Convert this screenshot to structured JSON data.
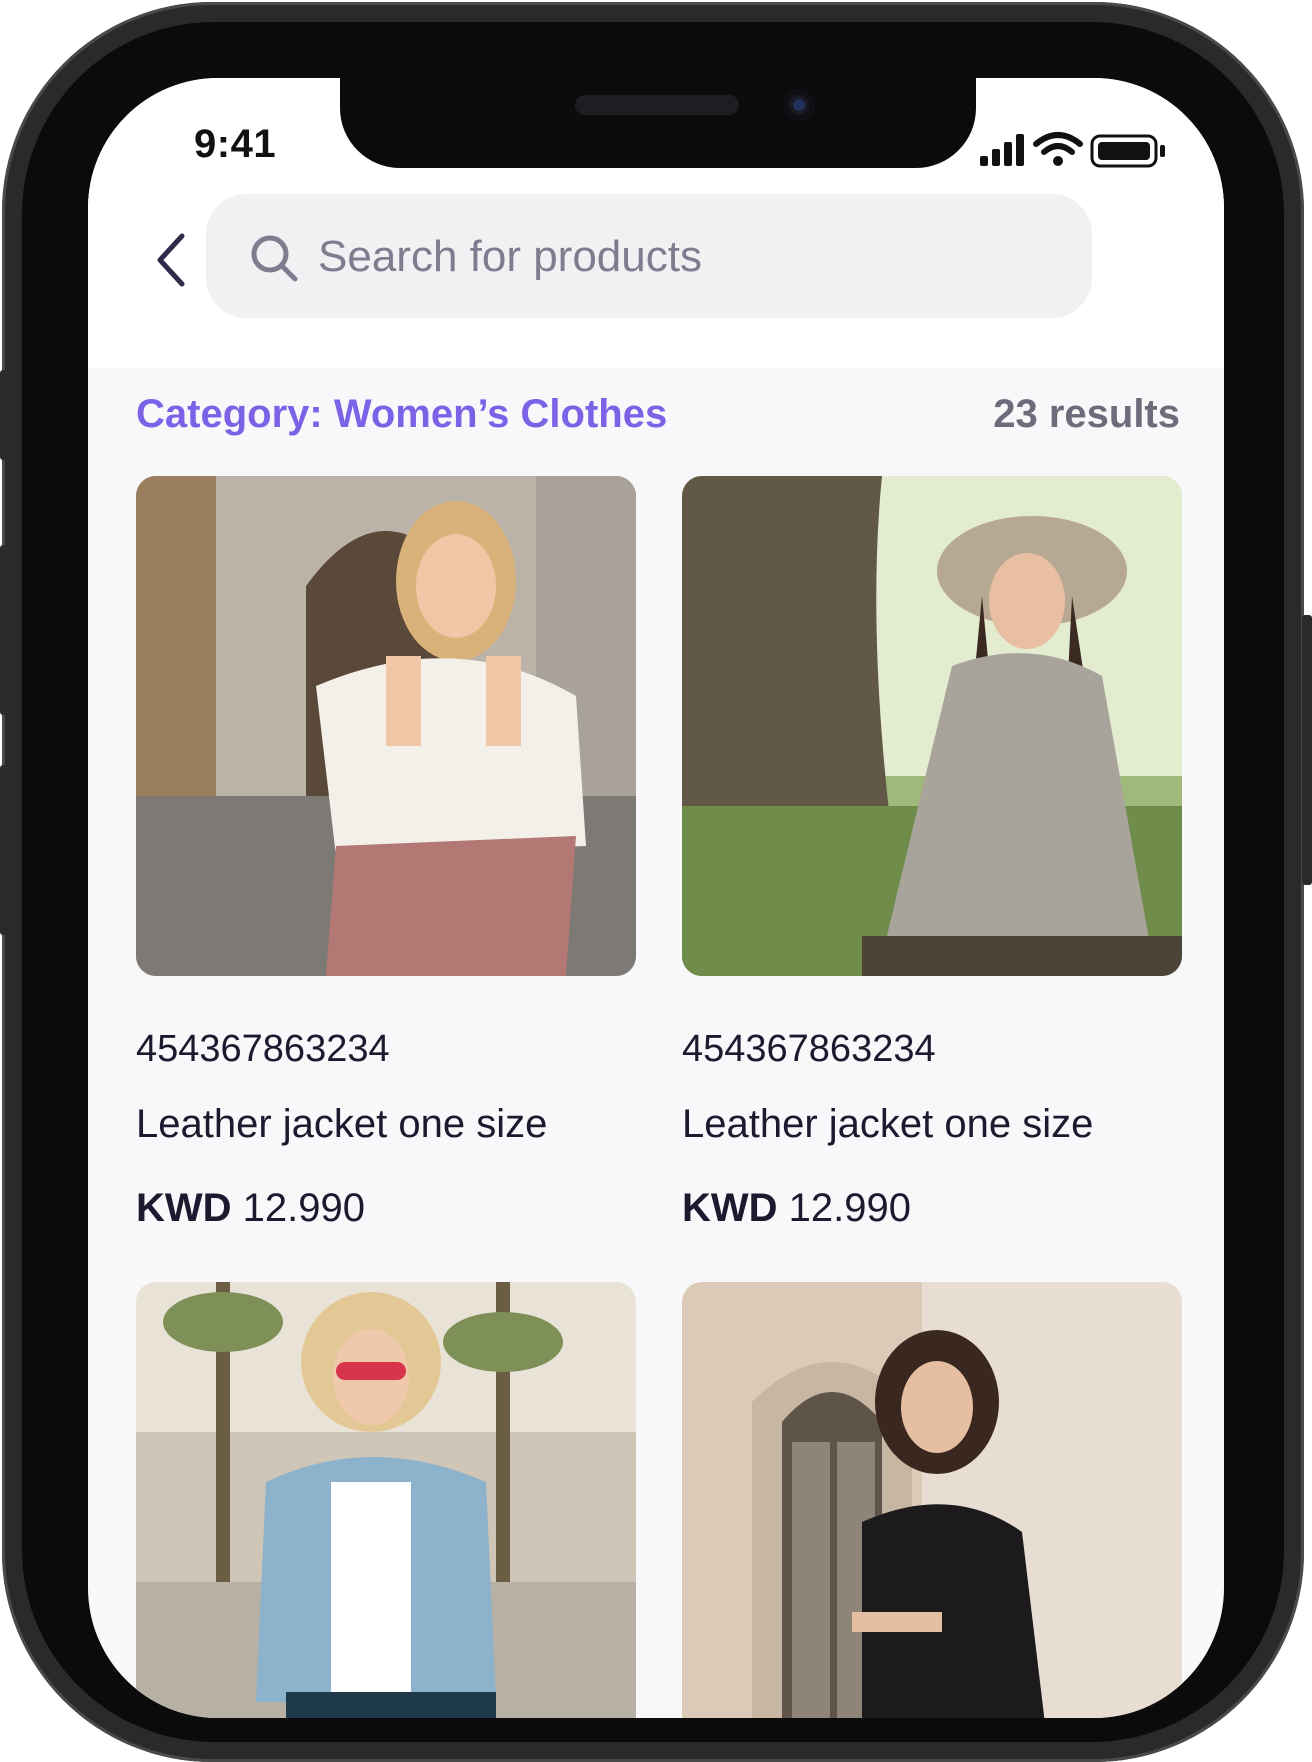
{
  "status_bar": {
    "time": "9:41"
  },
  "search": {
    "placeholder": "Search for products"
  },
  "category": {
    "label": "Category: Women’s Clothes",
    "results": "23 results"
  },
  "products": [
    {
      "sku": "454367863234",
      "name": "Leather jacket one size",
      "currency": "KWD",
      "price": "12.990"
    },
    {
      "sku": "454367863234",
      "name": "Leather jacket one size",
      "currency": "KWD",
      "price": "12.990"
    },
    {
      "sku": "",
      "name": "",
      "currency": "",
      "price": ""
    },
    {
      "sku": "",
      "name": "",
      "currency": "",
      "price": ""
    }
  ],
  "colors": {
    "accent": "#7b62e6",
    "text_dark": "#1b1a2e",
    "text_muted": "#6e6c7a",
    "search_bg": "#f1f1f4"
  },
  "icons": [
    "back-chevron-icon",
    "search-icon",
    "signal-icon",
    "wifi-icon",
    "battery-icon"
  ]
}
